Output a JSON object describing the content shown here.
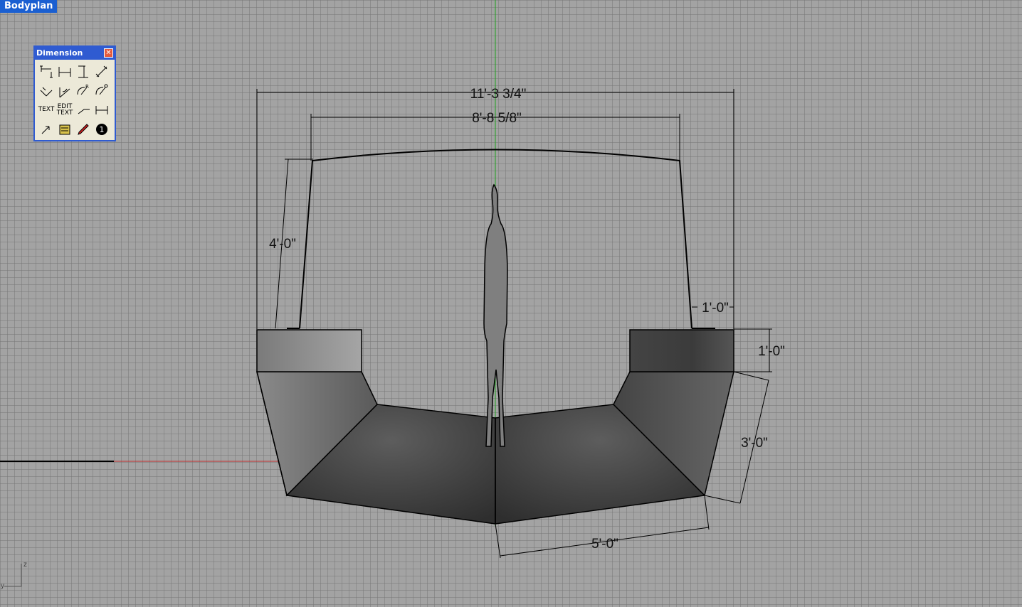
{
  "viewport": {
    "title": "Bodyplan"
  },
  "toolbar": {
    "title": "Dimension",
    "close_icon": "close-icon",
    "buttons": [
      {
        "name": "linear-dimension-icon",
        "label": ""
      },
      {
        "name": "horizontal-dimension-icon",
        "label": ""
      },
      {
        "name": "vertical-dimension-icon",
        "label": ""
      },
      {
        "name": "aligned-dimension-icon",
        "label": ""
      },
      {
        "name": "rotated-dimension-icon",
        "label": ""
      },
      {
        "name": "angle-dimension-icon",
        "label": ""
      },
      {
        "name": "radius-dimension-icon",
        "label": ""
      },
      {
        "name": "diameter-dimension-icon",
        "label": ""
      },
      {
        "name": "text-icon",
        "label": "TEXT"
      },
      {
        "name": "edit-text-icon",
        "label": "EDIT TEXT"
      },
      {
        "name": "leader-icon",
        "label": ""
      },
      {
        "name": "dim-style-icon",
        "label": ""
      },
      {
        "name": "recenter-text-icon",
        "label": ""
      },
      {
        "name": "dimension-properties-icon",
        "label": ""
      },
      {
        "name": "annotation-pencil-icon",
        "label": ""
      },
      {
        "name": "dot-icon",
        "label": ""
      }
    ]
  },
  "drawing": {
    "dims": {
      "overall_width": "11'-3 3/4\"",
      "top_width": "8'-8 5/8\"",
      "side_height": "4'-0\"",
      "ledge_offset": "1'-0\"",
      "deck_thickness": "1'-0\"",
      "hull_side": "3'-0\"",
      "bottom": "5'-0\""
    },
    "colors": {
      "line": "#000000",
      "hull_dark": "#3a3a3a",
      "hull_light": "#6e6e6e",
      "green_axis": "#1fa01f",
      "red_axis": "#c03030"
    }
  },
  "axis_widget": {
    "z": "z",
    "y": "y"
  }
}
